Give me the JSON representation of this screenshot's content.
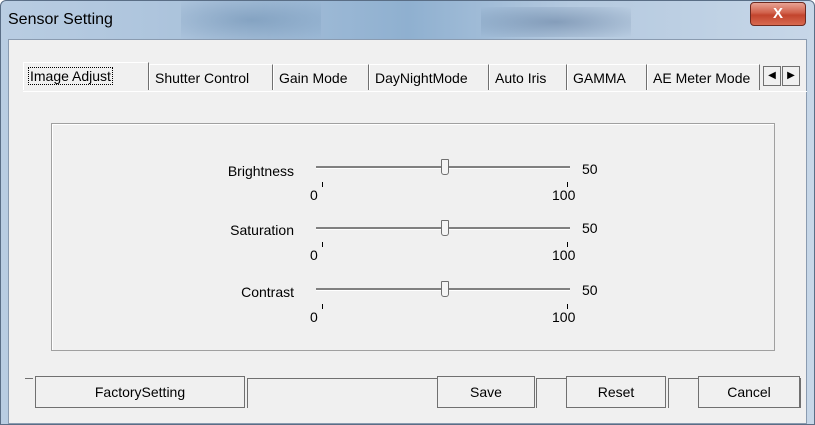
{
  "window": {
    "title": "Sensor Setting",
    "close_label": "X"
  },
  "tabs": [
    {
      "label": "Image Adjust",
      "active": true
    },
    {
      "label": "Shutter Control"
    },
    {
      "label": "Gain Mode"
    },
    {
      "label": "DayNightMode"
    },
    {
      "label": "Auto Iris"
    },
    {
      "label": "GAMMA"
    },
    {
      "label": "AE Meter Mode"
    }
  ],
  "tab_scroll": {
    "left": "◀",
    "right": "▶"
  },
  "sliders": [
    {
      "label": "Brightness",
      "min": "0",
      "max": "100",
      "value": 50,
      "value_label": "50"
    },
    {
      "label": "Saturation",
      "min": "0",
      "max": "100",
      "value": 50,
      "value_label": "50"
    },
    {
      "label": "Contrast",
      "min": "0",
      "max": "100",
      "value": 50,
      "value_label": "50"
    }
  ],
  "buttons": {
    "factory": "FactorySetting",
    "save": "Save",
    "reset": "Reset",
    "cancel": "Cancel"
  }
}
